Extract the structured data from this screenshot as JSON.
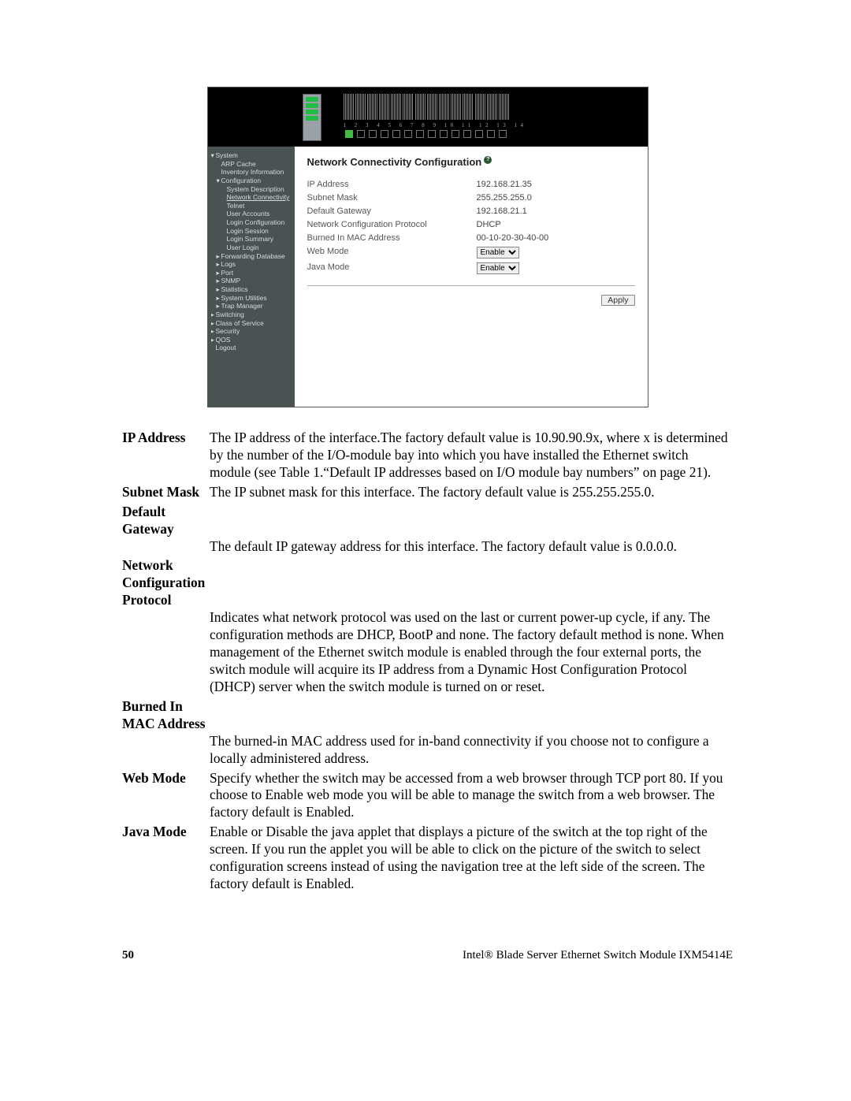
{
  "portNumbers": "1  2  3  4  5  6  7  8  9  10  11  12  13  14",
  "nav": {
    "items": [
      {
        "label": "System",
        "lvl": 1,
        "exp": "▾"
      },
      {
        "label": "ARP Cache",
        "lvl": 2
      },
      {
        "label": "Inventory Information",
        "lvl": 2
      },
      {
        "label": "Configuration",
        "lvl": 2,
        "exp": "▾"
      },
      {
        "label": "System Description",
        "lvl": 3
      },
      {
        "label": "Network Connectivity",
        "lvl": 3,
        "sel": true
      },
      {
        "label": "Telnet",
        "lvl": 3
      },
      {
        "label": "User Accounts",
        "lvl": 3
      },
      {
        "label": "Login Configuration",
        "lvl": 3
      },
      {
        "label": "Login Session",
        "lvl": 3
      },
      {
        "label": "Login Summary",
        "lvl": 3
      },
      {
        "label": "User Login",
        "lvl": 3
      },
      {
        "label": "Forwarding Database",
        "lvl": 2,
        "exp": "▸"
      },
      {
        "label": "Logs",
        "lvl": 2,
        "exp": "▸"
      },
      {
        "label": "Port",
        "lvl": 2,
        "exp": "▸"
      },
      {
        "label": "SNMP",
        "lvl": 2,
        "exp": "▸"
      },
      {
        "label": "Statistics",
        "lvl": 2,
        "exp": "▸"
      },
      {
        "label": "System Utilities",
        "lvl": 2,
        "exp": "▸"
      },
      {
        "label": "Trap Manager",
        "lvl": 2,
        "exp": "▸"
      },
      {
        "label": "Switching",
        "lvl": 1,
        "exp": "▸"
      },
      {
        "label": "Class of Service",
        "lvl": 1,
        "exp": "▸"
      },
      {
        "label": "Security",
        "lvl": 1,
        "exp": "▸"
      },
      {
        "label": "QOS",
        "lvl": 1,
        "exp": "▸"
      },
      {
        "label": "Logout",
        "lvl": 1
      }
    ]
  },
  "content": {
    "title": "Network Connectivity Configuration",
    "helpMark": "?",
    "rows": [
      {
        "label": "IP Address",
        "value": "192.168.21.35"
      },
      {
        "label": "Subnet Mask",
        "value": "255.255.255.0"
      },
      {
        "label": "Default Gateway",
        "value": "192.168.21.1"
      },
      {
        "label": "Network Configuration Protocol",
        "value": "DHCP"
      },
      {
        "label": "Burned In MAC Address",
        "value": "00-10-20-30-40-00"
      }
    ],
    "selectRows": [
      {
        "label": "Web Mode",
        "value": "Enable"
      },
      {
        "label": "Java Mode",
        "value": "Enable"
      }
    ],
    "applyLabel": "Apply"
  },
  "defs": [
    {
      "term": "IP Address",
      "body": "The IP address of the interface.The factory default value is 10.90.90.9x, where x is determined by the number of the I/O-module bay into which you have installed the Ethernet switch module (see Table 1.“Default IP addresses based on I/O module bay numbers” on page 21)."
    },
    {
      "term": "Subnet Mask",
      "body": "The IP subnet mask for this interface. The factory default value is 255.255.255.0."
    },
    {
      "term": "Default Gateway",
      "stack": true,
      "body": "The default IP gateway address for this interface. The factory default value is 0.0.0.0."
    },
    {
      "term": "Network Configuration Protocol",
      "stack": true,
      "body": "Indicates what network protocol was used on the last or current power-up cycle, if any. The configuration methods are DHCP, BootP and none. The factory default method is none. When management of the Ethernet switch module is enabled through the four external ports, the switch module will acquire its IP address from a Dynamic Host Configuration Protocol (DHCP) server when the switch module is turned on or reset."
    },
    {
      "term": "Burned In MAC Address",
      "stack": true,
      "body": "The burned-in MAC address used for in-band connectivity if you choose not to configure a locally administered address."
    },
    {
      "term": "Web Mode",
      "body": "Specify whether the switch may be accessed from a web browser through TCP port 80. If you choose to Enable web mode you will be able to manage the switch from a web browser. The factory default is Enabled."
    },
    {
      "term": "Java Mode",
      "body": "Enable or Disable the java applet that displays a picture of the switch at the top right of the screen. If you run the applet you will be able to click on the picture of the switch to select configuration screens instead of using the navigation tree at the left side of the screen. The factory default is Enabled."
    }
  ],
  "footer": {
    "pageNumber": "50",
    "bookTitle": "Intel® Blade Server Ethernet Switch Module IXM5414E"
  }
}
